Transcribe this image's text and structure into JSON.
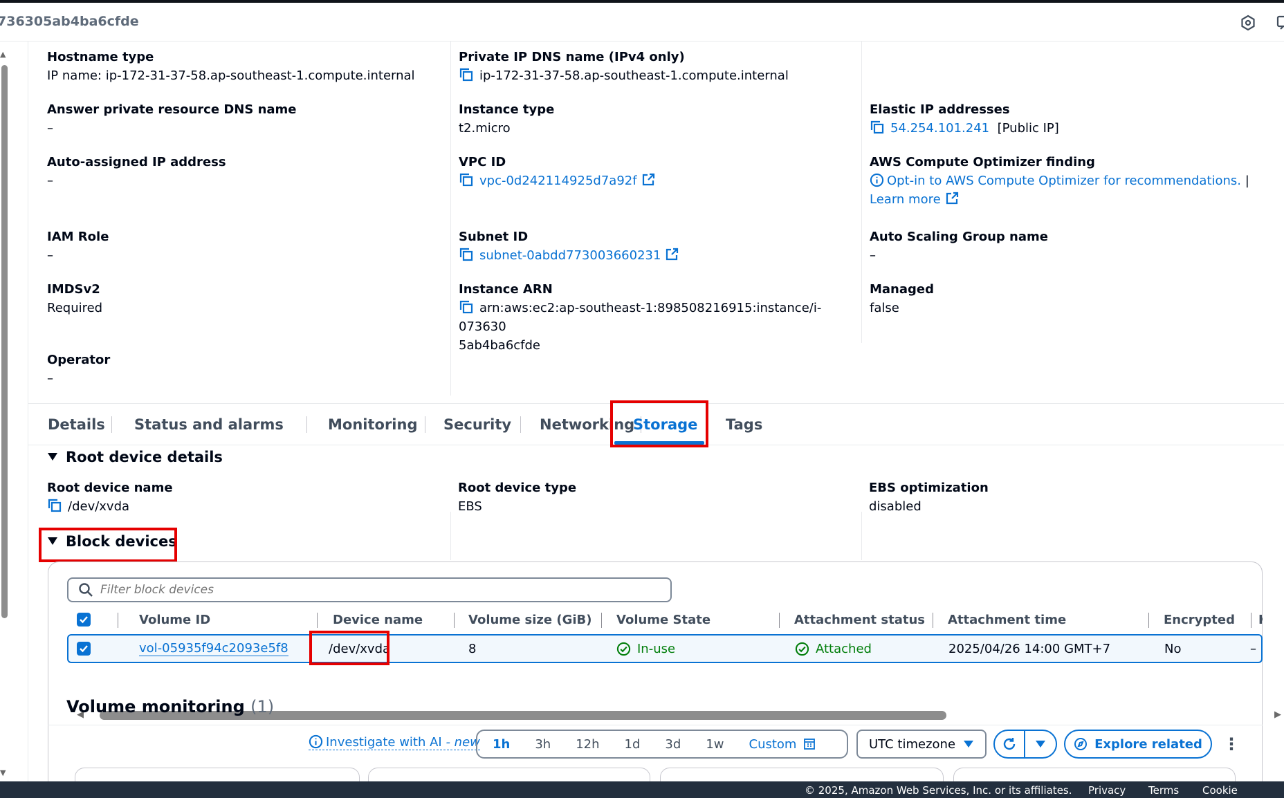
{
  "header": {
    "title": "736305ab4ba6cfde"
  },
  "details": {
    "col1": [
      {
        "key": "Hostname type",
        "value": "IP name: ip-172-31-37-58.ap-southeast-1.compute.internal"
      },
      {
        "key": "Answer private resource DNS name",
        "value": "–"
      },
      {
        "key": "Auto-assigned IP address",
        "value": "–"
      },
      {
        "key": "IAM Role",
        "value": "–"
      },
      {
        "key": "IMDSv2",
        "value": "Required"
      },
      {
        "key": "Operator",
        "value": "–"
      }
    ],
    "col2": [
      {
        "key": "Private IP DNS name (IPv4 only)",
        "value": "ip-172-31-37-58.ap-southeast-1.compute.internal"
      },
      {
        "key": "Instance type",
        "value": "t2.micro"
      },
      {
        "key": "VPC ID",
        "value": "vpc-0d242114925d7a92f"
      },
      {
        "key": "Subnet ID",
        "value": "subnet-0abdd773003660231"
      },
      {
        "key": "Instance ARN",
        "value": "arn:aws:ec2:ap-southeast-1:898508216915:instance/i-073630",
        "value2": "5ab4ba6cfde"
      }
    ],
    "col3": [
      {
        "key": "Elastic IP addresses",
        "value": "54.254.101.241",
        "suffix": "[Public IP]"
      },
      {
        "key": "AWS Compute Optimizer finding",
        "value": "Opt-in to AWS Compute Optimizer for recommendations.",
        "sep": "|",
        "learn": "Learn more"
      },
      {
        "key": "Auto Scaling Group name",
        "value": "–"
      },
      {
        "key": "Managed",
        "value": "false"
      }
    ]
  },
  "tabs": [
    "Details",
    "Status and alarms",
    "Monitoring",
    "Security",
    "Networking",
    "Storage",
    "Tags"
  ],
  "active_tab": "Storage",
  "root_device": {
    "heading": "Root device details",
    "name_label": "Root device name",
    "name_value": "/dev/xvda",
    "type_label": "Root device type",
    "type_value": "EBS",
    "ebs_label": "EBS optimization",
    "ebs_value": "disabled"
  },
  "block_devices": {
    "heading": "Block devices",
    "filter_placeholder": "Filter block devices",
    "columns": [
      "Volume ID",
      "Device name",
      "Volume size (GiB)",
      "Volume State",
      "Attachment status",
      "Attachment time",
      "Encrypted",
      "KI"
    ],
    "rows": [
      {
        "volume_id": "vol-05935f94c2093e5f8",
        "device_name": "/dev/xvda",
        "size": "8",
        "state": "In-use",
        "attachment": "Attached",
        "time": "2025/04/26 14:00 GMT+7",
        "encrypted": "No",
        "ki": "–"
      }
    ]
  },
  "volume_monitoring": {
    "title": "Volume monitoring",
    "count": "(1)",
    "investigate": "Investigate with AI",
    "investigate_new": "- new",
    "ranges": [
      "1h",
      "3h",
      "12h",
      "1d",
      "3d",
      "1w",
      "Custom"
    ],
    "selected_range": "1h",
    "timezone": "UTC timezone",
    "explore": "Explore related"
  },
  "footer": {
    "copyright": "© 2025, Amazon Web Services, Inc. or its affiliates.",
    "privacy": "Privacy",
    "terms": "Terms",
    "cookie": "Cookie preferences"
  },
  "colors": {
    "link": "#0972d3",
    "success": "#037f0c",
    "highlight": "#e50000",
    "footer_bg": "#232f3e"
  }
}
